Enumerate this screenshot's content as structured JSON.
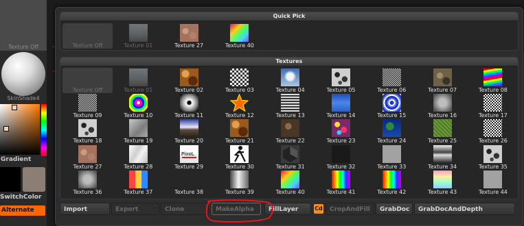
{
  "left_strip": {
    "texture_off_label": "Texture Off",
    "material_label": "SkinShade4",
    "gradient_label": "Gradient",
    "switch_color_label": "SwitchColor",
    "alternate_label": "Alternate",
    "colors": {
      "primary": "#000000",
      "secondary": "#8b7e74",
      "accent": "#ff6600"
    }
  },
  "quick_pick": {
    "title": "Quick Pick",
    "items": [
      {
        "label": "Texture Off",
        "swatch": "none",
        "state": "selected"
      },
      {
        "label": "Texture 01",
        "swatch": "sky",
        "state": "dimmed"
      },
      {
        "label": "Texture 27",
        "swatch": "granite",
        "state": "normal"
      },
      {
        "label": "Texture 40",
        "swatch": "spectrum",
        "state": "normal"
      }
    ]
  },
  "textures": {
    "title": "Textures",
    "items": [
      {
        "label": "Texture Off",
        "swatch": "none",
        "state": "selected"
      },
      {
        "label": "Texture 01",
        "swatch": "sky",
        "state": "dimmed"
      },
      {
        "label": "Texture 02",
        "swatch": "rust",
        "state": "normal"
      },
      {
        "label": "Texture 03",
        "swatch": "checker",
        "state": "normal"
      },
      {
        "label": "Texture 04",
        "swatch": "cloudsky",
        "state": "normal"
      },
      {
        "label": "Texture 05",
        "swatch": "blots",
        "state": "normal"
      },
      {
        "label": "Texture 06",
        "swatch": "noise",
        "state": "normal"
      },
      {
        "label": "Texture 07",
        "swatch": "rock",
        "state": "normal"
      },
      {
        "label": "Texture 08",
        "swatch": "rainbowstripes",
        "state": "normal"
      },
      {
        "label": "Texture 09",
        "swatch": "noise",
        "state": "normal"
      },
      {
        "label": "Texture 10",
        "swatch": "target",
        "state": "normal"
      },
      {
        "label": "Texture 11",
        "swatch": "radial",
        "state": "normal"
      },
      {
        "label": "Texture 12",
        "swatch": "star",
        "state": "normal"
      },
      {
        "label": "Texture 13",
        "swatch": "circuit",
        "state": "normal"
      },
      {
        "label": "Texture 14",
        "swatch": "water",
        "state": "normal"
      },
      {
        "label": "Texture 15",
        "swatch": "swirl",
        "state": "normal"
      },
      {
        "label": "Texture 16",
        "swatch": "haze",
        "state": "normal"
      },
      {
        "label": "Texture 17",
        "swatch": "speckle",
        "state": "normal"
      },
      {
        "label": "Texture 18",
        "swatch": "blots",
        "state": "normal"
      },
      {
        "label": "Texture 19",
        "swatch": "grayrock",
        "state": "normal"
      },
      {
        "label": "Texture 20",
        "swatch": "horizon",
        "state": "normal"
      },
      {
        "label": "Texture 21",
        "swatch": "rust",
        "state": "normal"
      },
      {
        "label": "Texture 22",
        "swatch": "brownrock",
        "state": "normal"
      },
      {
        "label": "Texture 23",
        "swatch": "bubbles",
        "state": "normal"
      },
      {
        "label": "Texture 24",
        "swatch": "earth",
        "state": "normal"
      },
      {
        "label": "Texture 25",
        "swatch": "grass",
        "state": "normal"
      },
      {
        "label": "Texture 26",
        "swatch": "speckle",
        "state": "normal"
      },
      {
        "label": "Texture 27",
        "swatch": "granite",
        "state": "normal"
      },
      {
        "label": "Texture 28",
        "swatch": "marble",
        "state": "normal"
      },
      {
        "label": "Texture 29",
        "swatch": "logo",
        "state": "normal"
      },
      {
        "label": "Texture 30",
        "swatch": "figure",
        "state": "normal"
      },
      {
        "label": "Texture 31",
        "swatch": "hexagon",
        "state": "normal"
      },
      {
        "label": "Texture 32",
        "swatch": "dark",
        "state": "normal"
      },
      {
        "label": "Texture 33",
        "swatch": "finenoise",
        "state": "normal"
      },
      {
        "label": "Texture 34",
        "swatch": "chrome",
        "state": "normal"
      },
      {
        "label": "Texture 35",
        "swatch": "blots",
        "state": "normal"
      },
      {
        "label": "Texture 36",
        "swatch": "haze",
        "state": "normal"
      },
      {
        "label": "Texture 37",
        "swatch": "mosaic",
        "state": "normal"
      },
      {
        "label": "Texture 38",
        "swatch": "empty",
        "state": "normal"
      },
      {
        "label": "Texture 39",
        "swatch": "cylinder",
        "state": "normal"
      },
      {
        "label": "Texture 40",
        "swatch": "spectrum",
        "state": "normal"
      },
      {
        "label": "Texture 41",
        "swatch": "rainbowbars",
        "state": "normal"
      },
      {
        "label": "Texture 42",
        "swatch": "rainbowbars",
        "state": "normal"
      },
      {
        "label": "Texture 43",
        "swatch": "pastel",
        "state": "normal"
      },
      {
        "label": "Texture 44",
        "swatch": "finenoise",
        "state": "normal"
      }
    ]
  },
  "buttons": {
    "import": "Import",
    "export": "Export",
    "clone": "Clone",
    "make_alpha": "MakeAlpha",
    "fill_layer": "FillLayer",
    "cd": "Cd",
    "crop_and_fill": "CropAndFill",
    "grab_doc": "GrabDoc",
    "grab_doc_and_depth": "GrabDocAndDepth"
  },
  "annotation_color": "#e01a1a"
}
